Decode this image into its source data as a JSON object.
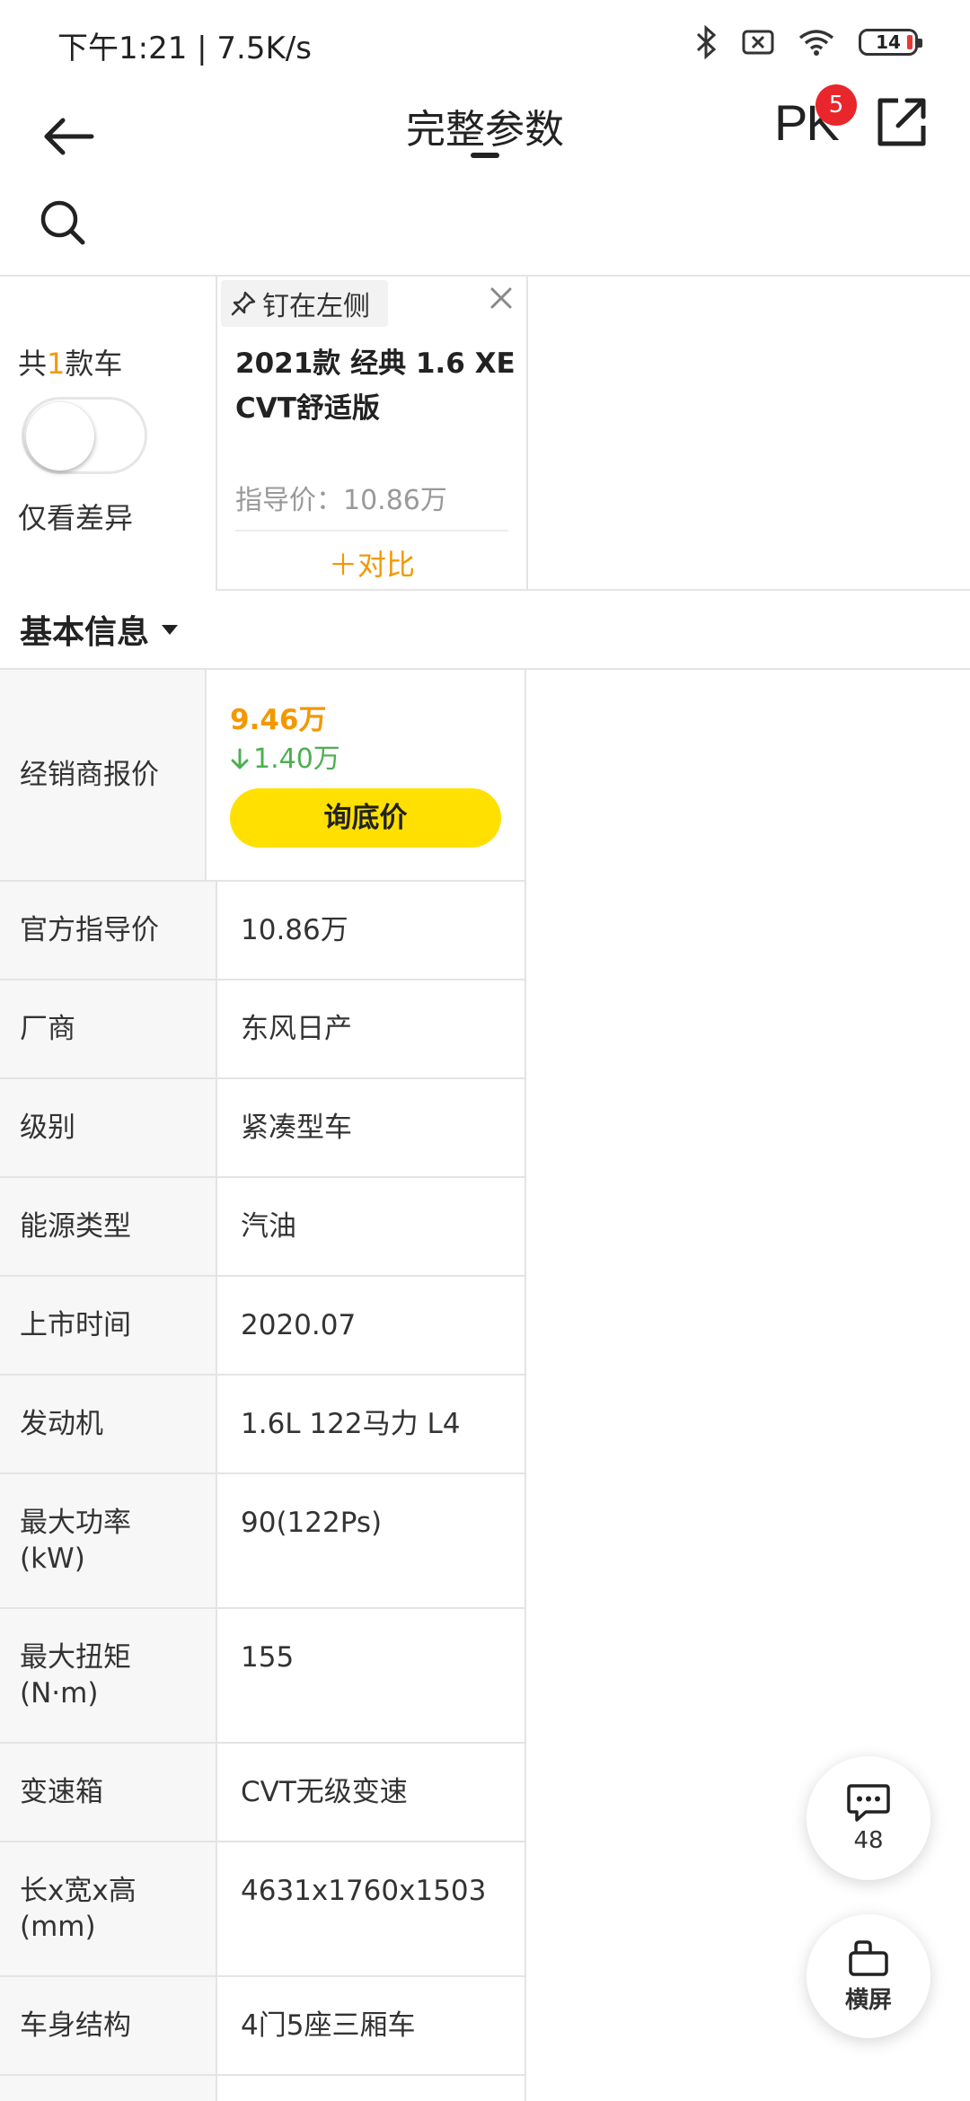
{
  "status_bar": {
    "time_speed": "下午1:21 | 7.5K/s",
    "battery": "14"
  },
  "nav": {
    "title": "完整参数",
    "pk_label": "PK",
    "pk_badge": "5"
  },
  "compare": {
    "total_prefix": "共",
    "total_count": "1",
    "total_suffix": "款车",
    "diff_label": "仅看差异",
    "diff_toggle_on": false,
    "car": {
      "pin_label": "钉在左侧",
      "name": "2021款 经典 1.6 XE CVT舒适版",
      "guide_price": "指导价：10.86万",
      "add_compare": "＋对比"
    }
  },
  "section": {
    "title": "基本信息"
  },
  "params": {
    "dealer_label": "经销商报价",
    "dealer_price": "9.46万",
    "price_drop": "1.40万",
    "ask_button": "询底价",
    "rows": [
      {
        "label": "官方指导价",
        "value": "10.86万"
      },
      {
        "label": "厂商",
        "value": "东风日产"
      },
      {
        "label": "级别",
        "value": "紧凑型车"
      },
      {
        "label": "能源类型",
        "value": "汽油"
      },
      {
        "label": "上市时间",
        "value": "2020.07"
      },
      {
        "label": "发动机",
        "value": "1.6L 122马力 L4"
      },
      {
        "label": "最大功率(kW)",
        "value": "90(122Ps)"
      },
      {
        "label": "最大扭矩(N·m)",
        "value": "155"
      },
      {
        "label": "变速箱",
        "value": "CVT无级变速"
      },
      {
        "label": "长x宽x高(mm)",
        "value": "4631x1760x1503"
      },
      {
        "label": "车身结构",
        "value": "4门5座三厢车"
      }
    ]
  },
  "floating": {
    "chat_count": "48",
    "landscape_label": "横屏"
  },
  "colors": {
    "accent_orange": "#f39800",
    "ask_yellow": "#ffe000",
    "drop_green": "#4caf50",
    "badge_red": "#e8262b"
  }
}
